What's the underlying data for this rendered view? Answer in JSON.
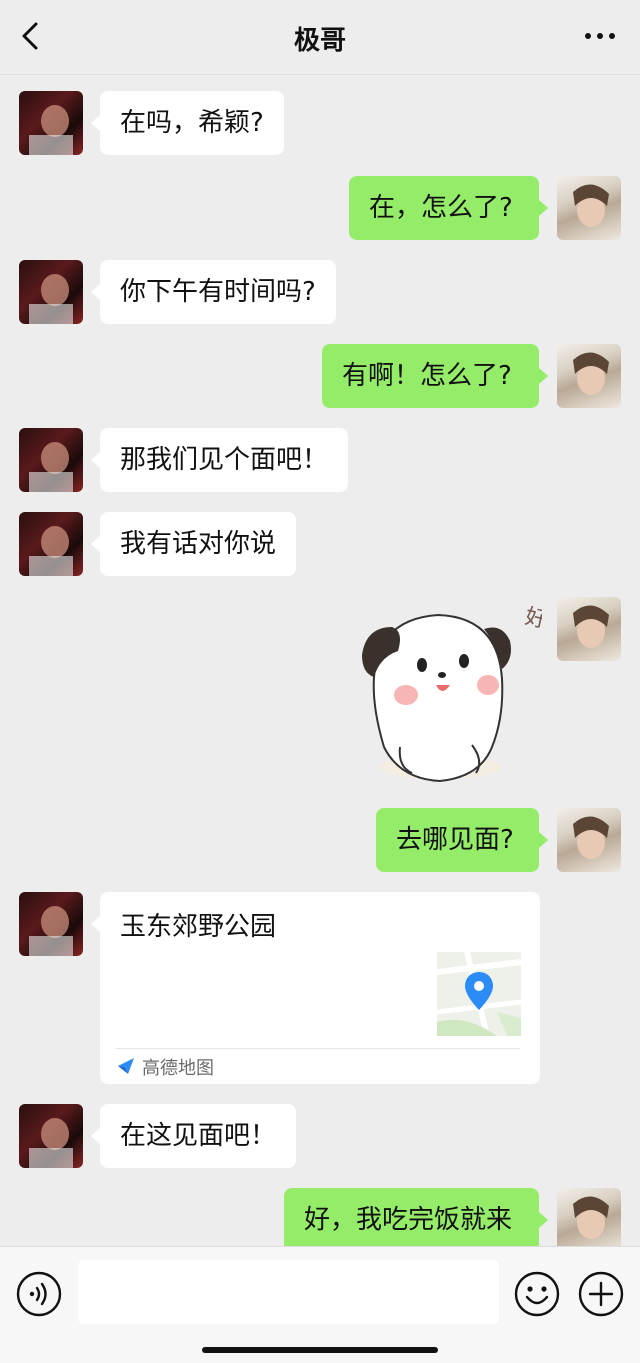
{
  "header": {
    "title": "极哥"
  },
  "messages": [
    {
      "text": "在吗，希颖?"
    },
    {
      "text": "在，怎么了?"
    },
    {
      "text": "你下午有时间吗?"
    },
    {
      "text": "有啊！怎么了?"
    },
    {
      "text": "那我们见个面吧！"
    },
    {
      "text": "我有话对你说"
    },
    {
      "sticker_text": "好！"
    },
    {
      "text": "去哪见面?"
    },
    {
      "location": {
        "title": "玉东郊野公园",
        "source": "高德地图"
      }
    },
    {
      "text": "在这见面吧！"
    },
    {
      "text": "好，我吃完饭就来"
    }
  ],
  "input": {
    "placeholder": ""
  },
  "colors": {
    "background": "#ededed",
    "bubble_self": "#95ec69",
    "bubble_other": "#ffffff",
    "map_pin": "#2a8cf4"
  },
  "icons": [
    "back-icon",
    "more-icon",
    "voice-icon",
    "emoji-icon",
    "plus-icon",
    "map-pin-icon",
    "amap-logo-icon"
  ]
}
